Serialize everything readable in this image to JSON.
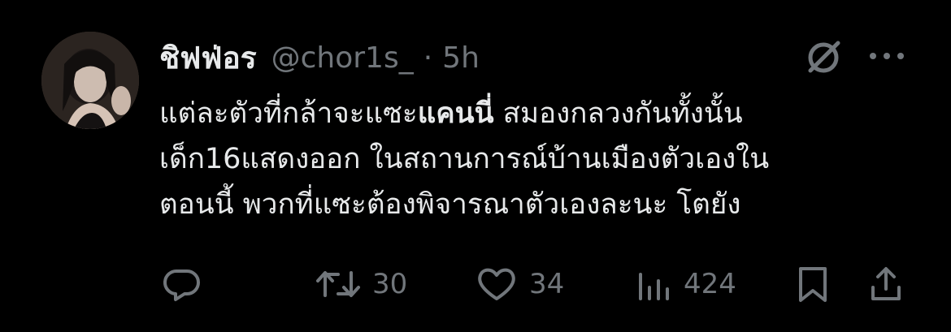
{
  "tweet": {
    "display_name": "ชิฟฟ่อร",
    "handle": "@chor1s_",
    "separator": "·",
    "time": "5h",
    "text_lines": [
      {
        "before": "แต่ละตัวที่กล้าจะแซะ",
        "mention": "แคนนี่",
        "after": " สมองกลวงกันทั้งนั้น"
      },
      {
        "text": "เด็ก16แสดงออก ในสถานการณ์บ้านเมืองตัวเองใน"
      },
      {
        "text": "ตอนนี้ พวกที่แซะต้องพิจารณาตัวเองละนะ โตยัง"
      }
    ],
    "stats": {
      "replies": "",
      "retweets": "30",
      "likes": "34",
      "views": "424"
    }
  },
  "icons": {
    "avatar": "profile-photo",
    "grok": "grok-icon",
    "more": "more-icon",
    "reply": "reply-icon",
    "retweet": "retweet-icon",
    "like": "heart-icon",
    "views": "views-icon",
    "bookmark": "bookmark-icon",
    "share": "share-icon"
  },
  "colors": {
    "background": "#000000",
    "text": "#e7e9ea",
    "secondary": "#71767b"
  }
}
